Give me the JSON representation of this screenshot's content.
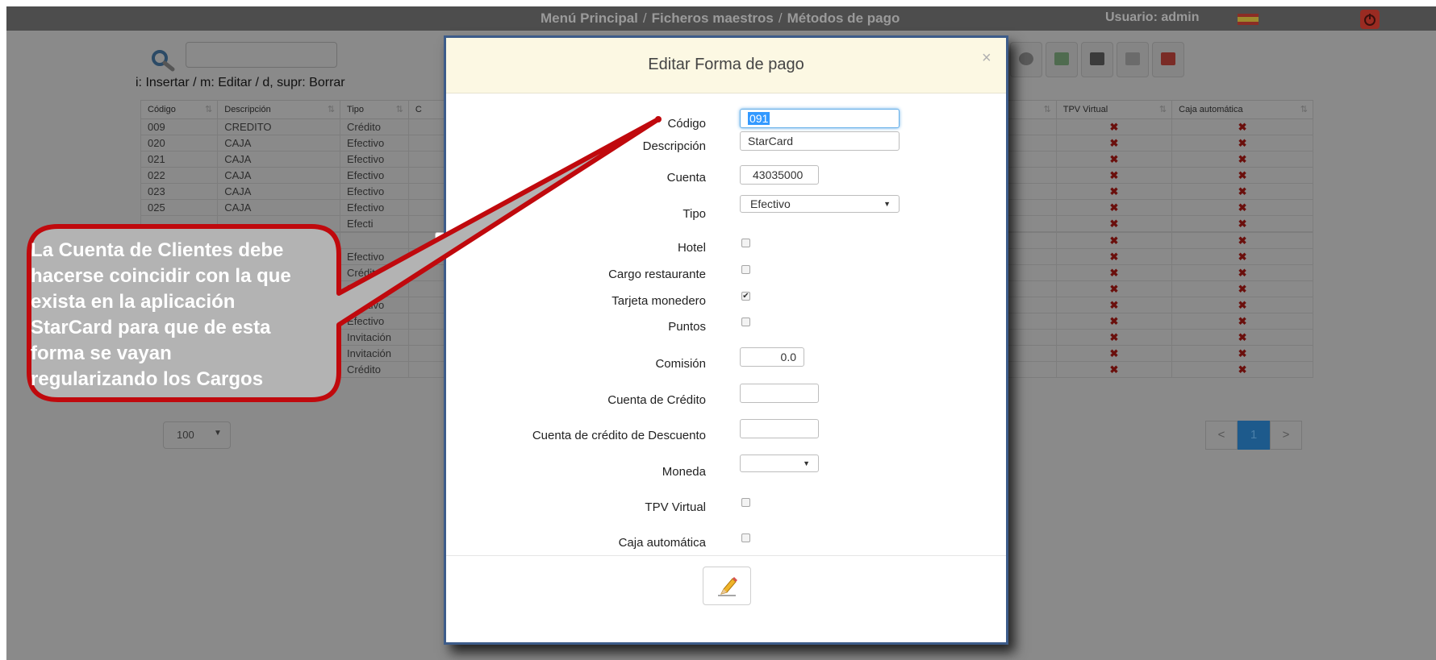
{
  "nav": {
    "breadcrumb": [
      "Menú Principal",
      "Ficheros maestros",
      "Métodos de pago"
    ],
    "separator": "/",
    "user": "Usuario: admin"
  },
  "toolbar": {
    "hint": "i: Insertar / m: Editar / d, supr: Borrar",
    "icons": [
      "eye-icon",
      "edit-file-icon",
      "print-icon",
      "export-icon",
      "pdf-icon"
    ]
  },
  "table": {
    "headers": [
      "Código",
      "Descripción",
      "Tipo",
      "C",
      "TPV Virtual",
      "Caja automática"
    ],
    "rows": [
      {
        "codigo": "009",
        "descripcion": "CREDITO",
        "tipo": "Crédito",
        "tpv": "✖",
        "caja": "✖"
      },
      {
        "codigo": "020",
        "descripcion": "CAJA",
        "tipo": "Efectivo",
        "tpv": "✖",
        "caja": "✖"
      },
      {
        "codigo": "021",
        "descripcion": "CAJA",
        "tipo": "Efectivo",
        "tpv": "✖",
        "caja": "✖"
      },
      {
        "codigo": "022",
        "descripcion": "CAJA",
        "tipo": "Efectivo",
        "tpv": "✖",
        "caja": "✖"
      },
      {
        "codigo": "023",
        "descripcion": "CAJA",
        "tipo": "Efectivo",
        "tpv": "✖",
        "caja": "✖"
      },
      {
        "codigo": "025",
        "descripcion": "CAJA",
        "tipo": "Efectivo",
        "tpv": "✖",
        "caja": "✖"
      },
      {
        "codigo": "",
        "descripcion": "",
        "tipo": "Efecti",
        "tpv": "✖",
        "caja": "✖"
      },
      {
        "codigo": "",
        "descripcion": "",
        "tipo": "",
        "tpv": "✖",
        "caja": "✖"
      },
      {
        "codigo": "",
        "descripcion": "",
        "tipo": "",
        "tpv": "✖",
        "caja": "✖"
      },
      {
        "codigo": "",
        "descripcion": "",
        "tipo": "Efectivo",
        "tpv": "✖",
        "caja": "✖"
      },
      {
        "codigo": "",
        "descripcion": "",
        "tipo": "Crédito",
        "tpv": "✖",
        "caja": "✖"
      },
      {
        "codigo": "",
        "descripcion": "",
        "tipo": "Efectivo",
        "tpv": "✖",
        "caja": "✖"
      },
      {
        "codigo": "",
        "descripcion": "",
        "tipo": "Efectivo",
        "tpv": "✖",
        "caja": "✖"
      },
      {
        "codigo": "",
        "descripcion": "",
        "tipo": "Efectivo",
        "tpv": "✖",
        "caja": "✖"
      },
      {
        "codigo": "",
        "descripcion": "",
        "tipo": "Invitación",
        "tpv": "✖",
        "caja": "✖"
      },
      {
        "codigo": "",
        "descripcion": "",
        "tipo": "Invitación",
        "tpv": "✖",
        "caja": "✖"
      },
      {
        "codigo": "",
        "descripcion": "",
        "tipo": "Crédito",
        "tpv": "✖",
        "caja": "✖"
      }
    ]
  },
  "pagination": {
    "page_size": "100",
    "prev": "<",
    "current": "1",
    "next": ">"
  },
  "modal": {
    "title": "Editar Forma de pago",
    "close": "×",
    "labels": {
      "codigo": "Código",
      "descripcion": "Descripción",
      "cuenta": "Cuenta",
      "tipo": "Tipo",
      "hotel": "Hotel",
      "cargo_restaurante": "Cargo restaurante",
      "tarjeta_monedero": "Tarjeta monedero",
      "puntos": "Puntos",
      "comision": "Comisión",
      "cuenta_credito": "Cuenta de Crédito",
      "cuenta_credito_descuento": "Cuenta de crédito de Descuento",
      "moneda": "Moneda",
      "tpv_virtual": "TPV Virtual",
      "caja_automatica": "Caja automática"
    },
    "values": {
      "codigo": "091",
      "descripcion": "StarCard",
      "cuenta": "43035000",
      "tipo": "Efectivo",
      "comision": "0.0",
      "cuenta_credito": "",
      "cuenta_credito_descuento": "",
      "moneda": "",
      "tarjeta_monedero_check": "✔"
    }
  },
  "callout": {
    "lines": [
      "La Cuenta de Clientes debe",
      "hacerse coincidir con la que",
      "exista en la aplicación",
      "StarCard para que de esta",
      "forma se vayan",
      "regularizando los Cargos"
    ],
    "fill": "#b3b3b3",
    "border": "#c0090d"
  }
}
